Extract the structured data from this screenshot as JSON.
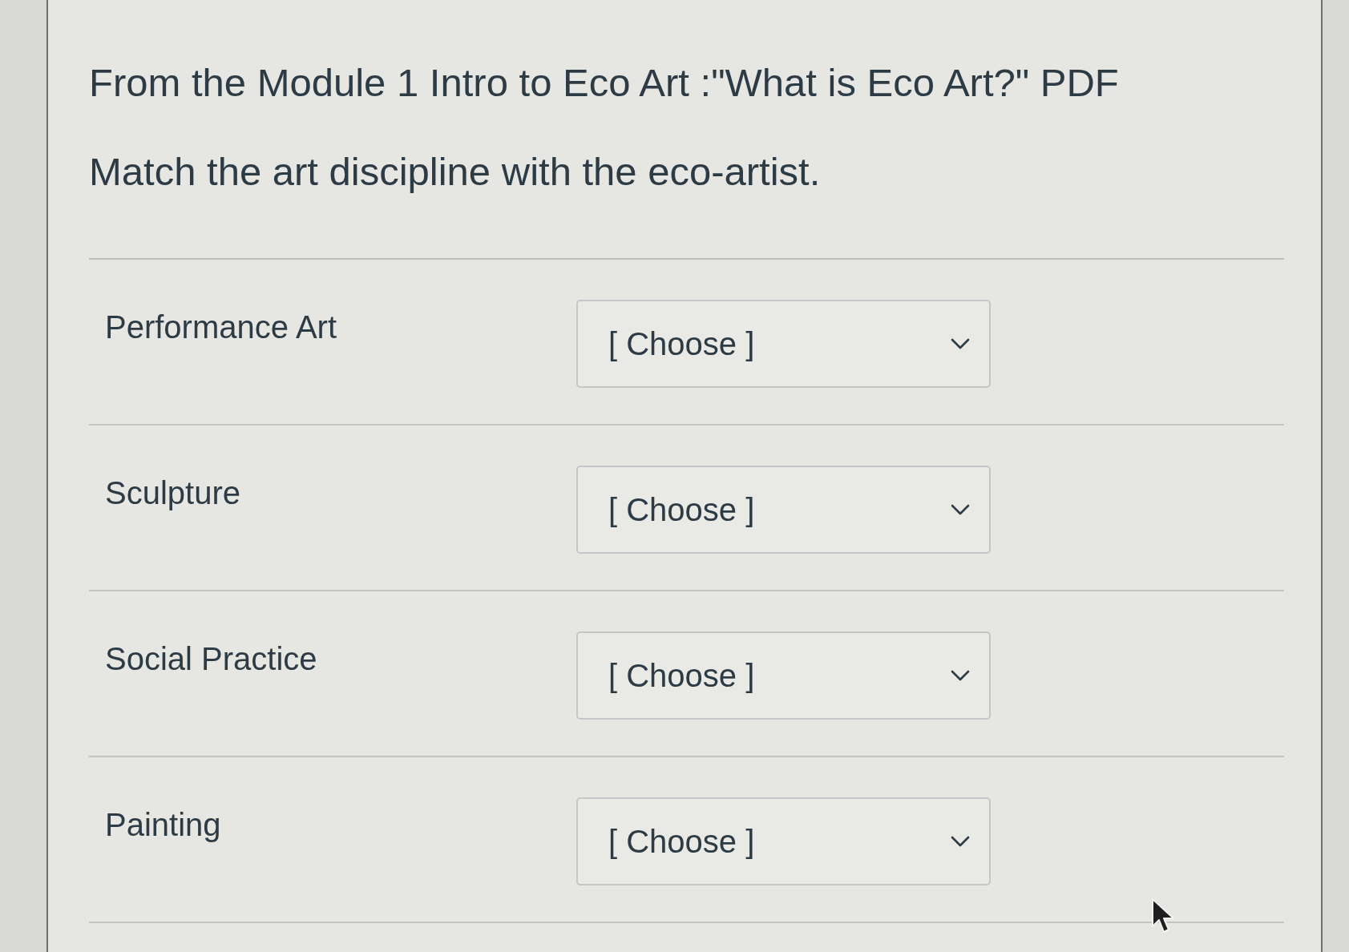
{
  "question": {
    "source": "From the Module 1 Intro to Eco Art :\"What is Eco Art?\" PDF",
    "prompt": "Match the art discipline with the eco-artist."
  },
  "matches": [
    {
      "label": "Performance Art",
      "select": {
        "value": "[ Choose ]"
      }
    },
    {
      "label": "Sculpture",
      "select": {
        "value": "[ Choose ]"
      }
    },
    {
      "label": "Social Practice",
      "select": {
        "value": "[ Choose ]"
      }
    },
    {
      "label": "Painting",
      "select": {
        "value": "[ Choose ]"
      }
    }
  ]
}
